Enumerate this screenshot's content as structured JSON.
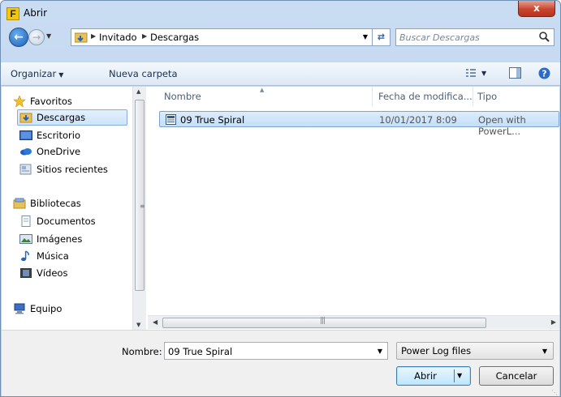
{
  "window": {
    "title": "Abrir",
    "close_label": "x"
  },
  "address": {
    "crumbs": [
      "Invitado",
      "Descargas"
    ],
    "search_placeholder": "Buscar Descargas"
  },
  "toolbar": {
    "organize_label": "Organizar",
    "new_folder_label": "Nueva carpeta"
  },
  "nav": {
    "favorites": {
      "label": "Favoritos",
      "items": [
        {
          "label": "Descargas",
          "icon": "downloads-folder-icon",
          "selected": true
        },
        {
          "label": "Escritorio",
          "icon": "desktop-icon"
        },
        {
          "label": "OneDrive",
          "icon": "onedrive-icon"
        },
        {
          "label": "Sitios recientes",
          "icon": "recent-places-icon"
        }
      ]
    },
    "libraries": {
      "label": "Bibliotecas",
      "items": [
        {
          "label": "Documentos",
          "icon": "documents-icon"
        },
        {
          "label": "Imágenes",
          "icon": "pictures-icon"
        },
        {
          "label": "Música",
          "icon": "music-icon"
        },
        {
          "label": "Vídeos",
          "icon": "videos-icon"
        }
      ]
    },
    "computer": {
      "label": "Equipo"
    }
  },
  "files": {
    "columns": [
      "Nombre",
      "Fecha de modifica...",
      "Tipo"
    ],
    "rows": [
      {
        "name": "09 True Spiral",
        "date": "10/01/2017 8:09",
        "type": "Open with PowerL..."
      }
    ]
  },
  "bottom": {
    "name_label": "Nombre:",
    "name_value": "09 True Spiral",
    "filter_value": "Power Log files",
    "open_label": "Abrir",
    "cancel_label": "Cancelar"
  },
  "colors": {
    "accent": "#3c7fb1",
    "selection": "#cde4fa",
    "close_button": "#c8452f"
  }
}
